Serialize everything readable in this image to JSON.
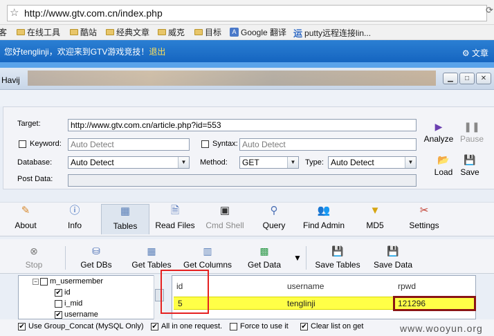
{
  "browser": {
    "url": "http://www.gtv.com.cn/index.php",
    "bookmarks": [
      {
        "label": "客",
        "icon": "folder-icon"
      },
      {
        "label": "在线工具",
        "icon": "folder-icon"
      },
      {
        "label": "酷站",
        "icon": "folder-icon"
      },
      {
        "label": "经典文章",
        "icon": "folder-icon"
      },
      {
        "label": "威克",
        "icon": "folder-icon"
      },
      {
        "label": "目标",
        "icon": "folder-icon"
      },
      {
        "label": "Google 翻译",
        "icon": "google-translate-icon"
      },
      {
        "label": "putty远程连接lin...",
        "icon": "putty-icon"
      }
    ]
  },
  "site": {
    "welcome": "您好tenglinji，欢迎来到GTV游戏竞技！",
    "logout": "退出",
    "lang": "文章"
  },
  "app": {
    "title": "Havij"
  },
  "target_panel": {
    "target_label": "Target:",
    "target_value": "http://www.gtv.com.cn/article.php?id=553",
    "keyword_label": "Keyword:",
    "keyword_placeholder": "Auto Detect",
    "syntax_label": "Syntax:",
    "syntax_placeholder": "Auto Detect",
    "database_label": "Database:",
    "database_value": "Auto Detect",
    "method_label": "Method:",
    "method_value": "GET",
    "type_label": "Type:",
    "type_value": "Auto Detect",
    "postdata_label": "Post Data:",
    "analyze_label": "Analyze",
    "pause_label": "Pause",
    "load_label": "Load",
    "save_label": "Save"
  },
  "tabs": [
    {
      "label": "About",
      "icon": "about-icon"
    },
    {
      "label": "Info",
      "icon": "info-icon"
    },
    {
      "label": "Tables",
      "icon": "tables-icon"
    },
    {
      "label": "Read Files",
      "icon": "read-files-icon"
    },
    {
      "label": "Cmd Shell",
      "icon": "cmd-shell-icon"
    },
    {
      "label": "Query",
      "icon": "query-icon"
    },
    {
      "label": "Find Admin",
      "icon": "find-admin-icon"
    },
    {
      "label": "MD5",
      "icon": "md5-icon"
    },
    {
      "label": "Settings",
      "icon": "settings-icon"
    }
  ],
  "active_tab": "Tables",
  "subtoolbar": {
    "stop": "Stop",
    "get_dbs": "Get DBs",
    "get_tables": "Get Tables",
    "get_columns": "Get Columns",
    "get_data": "Get Data",
    "save_tables": "Save Tables",
    "save_data": "Save Data"
  },
  "tree": [
    {
      "label": "m_usermember",
      "checked": false,
      "expand": "−"
    },
    {
      "label": "id",
      "checked": true
    },
    {
      "label": "i_mid",
      "checked": false
    },
    {
      "label": "username",
      "checked": true
    }
  ],
  "grid": {
    "columns": [
      "id",
      "username",
      "rpwd"
    ],
    "rows": [
      [
        "5",
        "tenglinji",
        "121296"
      ]
    ]
  },
  "options": {
    "group_concat": "Use Group_Concat (MySQL Only)",
    "all_in_one": "All in one request.",
    "force": "Force to use it",
    "clear_list": "Clear list on get"
  },
  "watermark": "www.wooyun.org",
  "colors": {
    "site_bar": "#1a6fc8",
    "row_highlight": "#ffff47",
    "highlight_box": "#e52020"
  }
}
